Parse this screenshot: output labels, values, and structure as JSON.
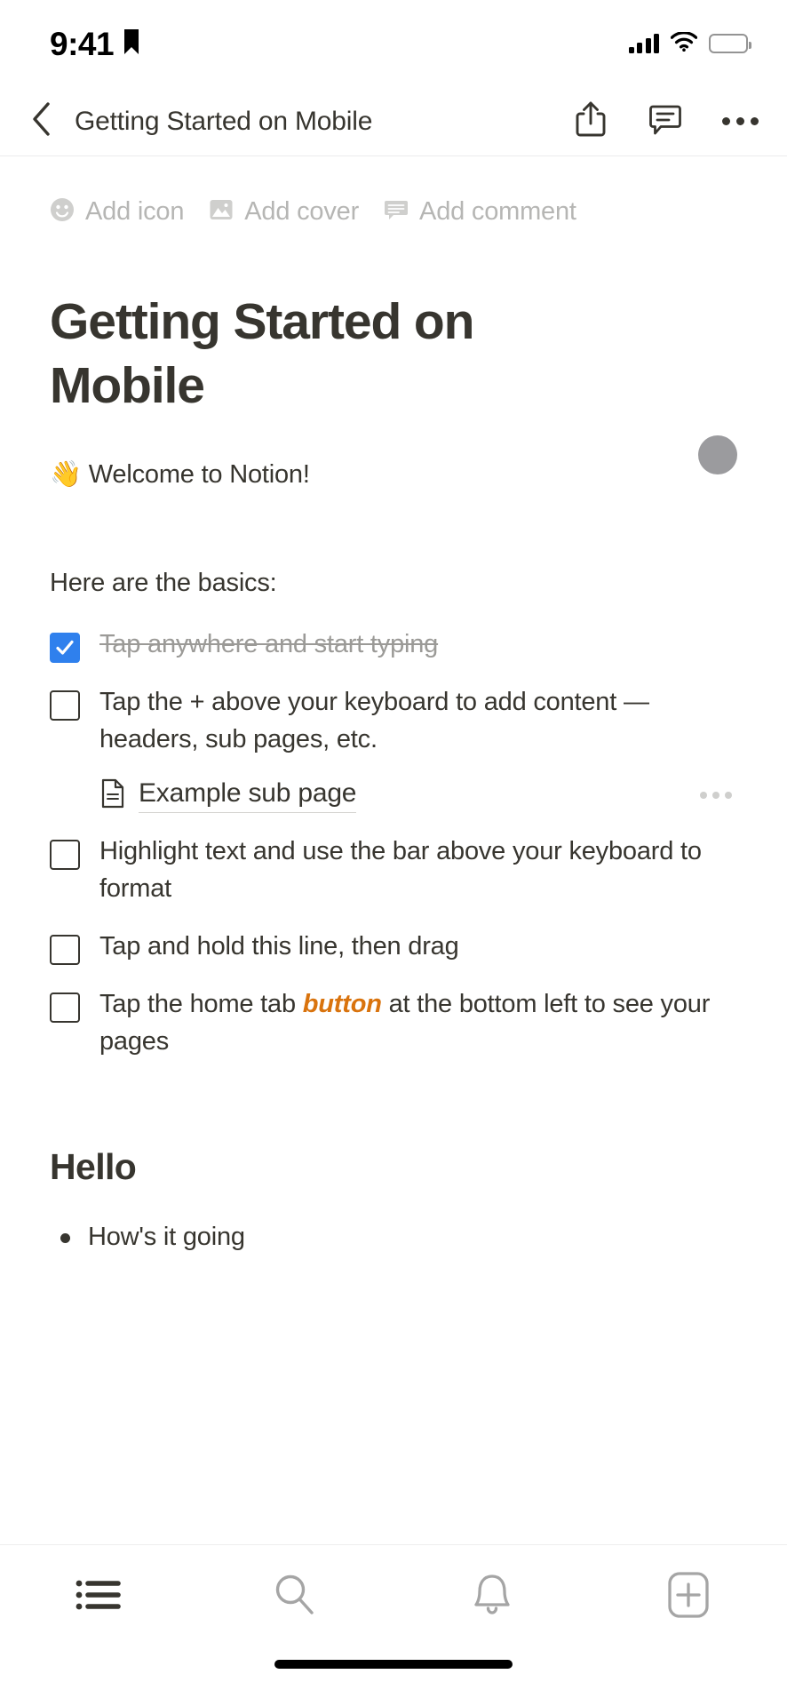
{
  "status_bar": {
    "time": "9:41",
    "location_icon": "location-arrow-icon",
    "signal_icon": "cellular-signal-icon",
    "wifi_icon": "wifi-icon",
    "battery_icon": "battery-full-icon"
  },
  "nav_bar": {
    "back_icon": "chevron-left-icon",
    "title": "Getting Started on Mobile",
    "actions": [
      {
        "name": "share-button",
        "icon": "share-icon"
      },
      {
        "name": "comment-button",
        "icon": "comment-icon"
      },
      {
        "name": "more-button",
        "icon": "more-horizontal-icon"
      }
    ]
  },
  "page": {
    "add_row": [
      {
        "icon": "smiley-icon",
        "label": "Add icon"
      },
      {
        "icon": "image-icon",
        "label": "Add cover"
      },
      {
        "icon": "comment-bubble-icon",
        "label": "Add comment"
      }
    ],
    "title": "Getting Started on Mobile",
    "avatar": {
      "name": "page-avatar",
      "color": "#9b9b9e"
    },
    "welcome": {
      "emoji": "👋",
      "text": "Welcome to Notion!"
    },
    "basics_label": "Here are the basics:",
    "todos": [
      {
        "checked": true,
        "text": "Tap anywhere and start typing"
      },
      {
        "checked": false,
        "text": "Tap the + above your keyboard to add content — headers, sub pages, etc."
      },
      {
        "checked": false,
        "text": "Highlight text and use the bar above your keyboard to format"
      },
      {
        "checked": false,
        "text": "Tap and hold this line, then drag"
      },
      {
        "checked": false,
        "text_before": "Tap the home tab ",
        "highlight": "button",
        "text_after": " at the bottom left to see your pages"
      }
    ],
    "subpage": {
      "icon": "page-document-icon",
      "title": "Example sub page",
      "more_icon": "more-horizontal-icon"
    },
    "heading2": "Hello",
    "bullet": "How's it going"
  },
  "tab_bar": {
    "tabs": [
      {
        "name": "tab-home",
        "icon": "list-icon",
        "active": true
      },
      {
        "name": "tab-search",
        "icon": "search-icon",
        "active": false
      },
      {
        "name": "tab-notifications",
        "icon": "bell-icon",
        "active": false
      },
      {
        "name": "tab-new-page",
        "icon": "plus-box-icon",
        "active": false
      }
    ]
  },
  "colors": {
    "text": "#37352f",
    "muted": "#9b9a97",
    "placeholder": "#b6b6b4",
    "accent_blue": "#2f80ed",
    "accent_orange": "#d9730d",
    "tab_inactive": "#a5a5a5",
    "tab_active": "#37352f"
  }
}
